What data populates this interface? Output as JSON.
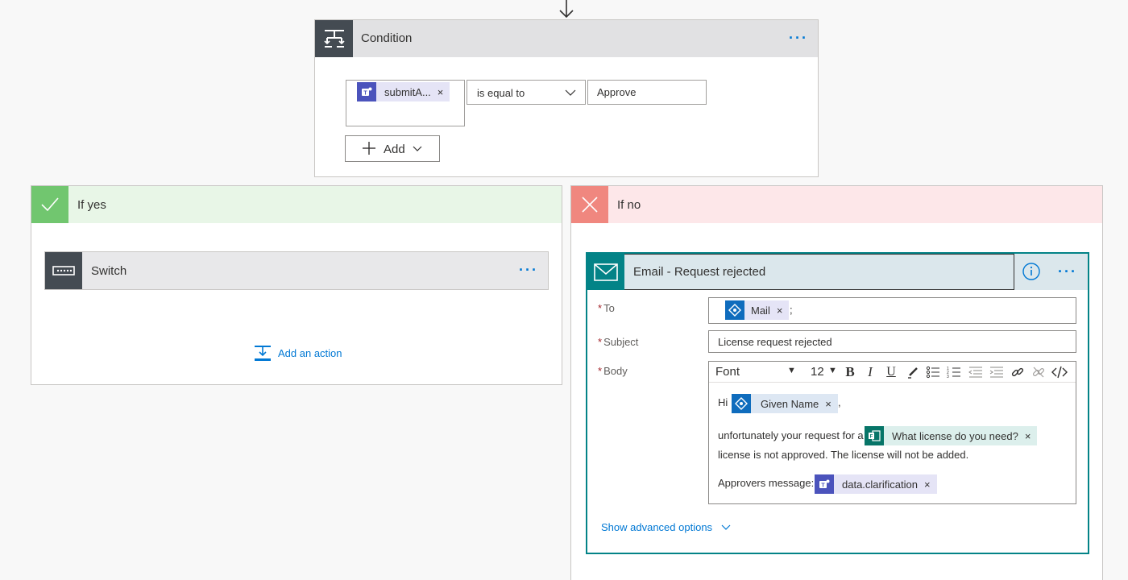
{
  "condition": {
    "title": "Condition",
    "more": "···",
    "left_token": "submitA...",
    "token_remove": "×",
    "operator": "is equal to",
    "value": "Approve",
    "add_label": "Add"
  },
  "if_yes": {
    "title": "If yes",
    "switch_title": "Switch",
    "more": "···",
    "add_action": "Add an action"
  },
  "if_no": {
    "title": "If no",
    "email": {
      "title": "Email - Request rejected",
      "more": "···",
      "to_label": "To",
      "subject_label": "Subject",
      "body_label": "Body",
      "required_mark": "*",
      "to_token": "Mail",
      "to_separator": ";",
      "subject_value": "License request rejected",
      "font_label": "Font",
      "font_size": "12",
      "toolbar": {
        "bold": "B",
        "italic": "I",
        "underline": "U"
      },
      "body": {
        "greeting": "Hi",
        "name_token": "Given Name",
        "comma": ",",
        "line2": "unfortunately your request for a",
        "license_token": "What license do you need?",
        "line3": "license is not approved. The license will not be added.",
        "line4": "Approvers message:",
        "clar_token": "data.clarification"
      },
      "show_advanced": "Show advanced options"
    }
  },
  "icons": {
    "condition": "condition-icon",
    "switch": "switch-icon",
    "email": "mail-icon",
    "teams": "teams-icon",
    "azure_ad": "azure-ad-icon",
    "forms": "forms-icon"
  },
  "colors": {
    "accent": "#0078d4",
    "email_accent": "#038387",
    "yes_green": "#71c66f",
    "no_red": "#f0877f",
    "header_gray": "#444b52"
  }
}
